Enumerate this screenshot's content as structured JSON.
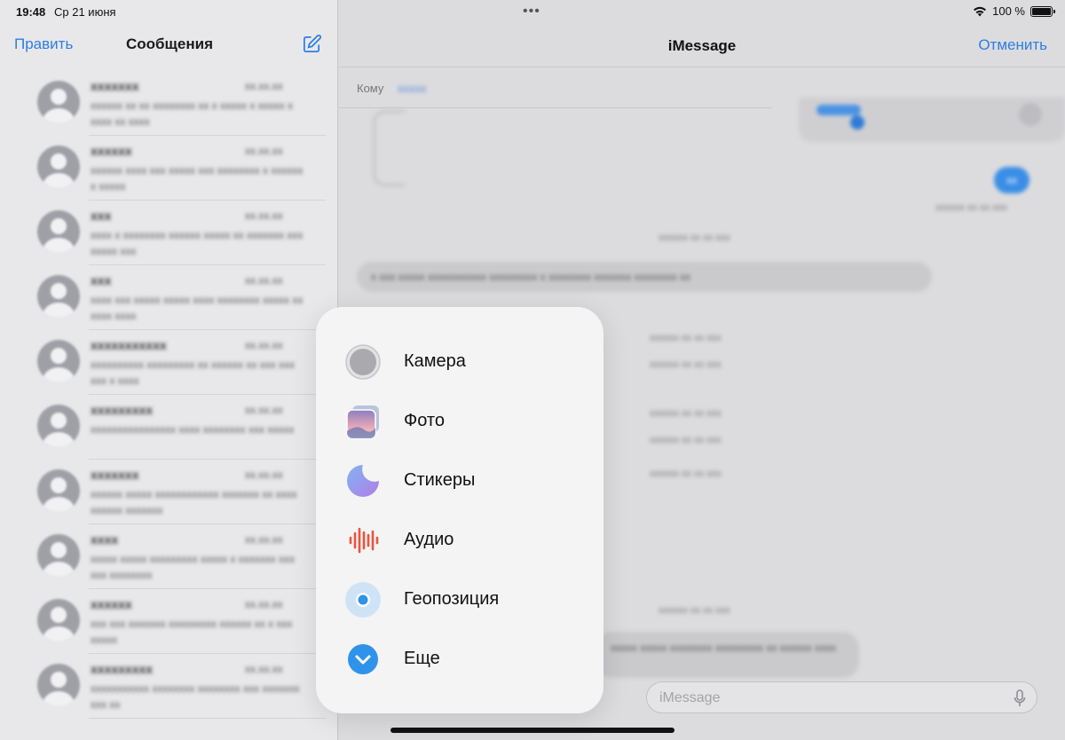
{
  "status_bar": {
    "time": "19:48",
    "date": "Ср 21 июня",
    "dots": "•••",
    "battery_percent": "100 %"
  },
  "sidebar": {
    "edit_label": "Править",
    "title": "Сообщения",
    "conversations": [
      {
        "name": "xxxxxxx",
        "time": "xx.xx.xx",
        "preview": "xxxxxx xx xx xxxxxxxx xx x xxxxx x xxxxx x xxxx xx xxxx"
      },
      {
        "name": "xxxxxx",
        "time": "xx.xx.xx",
        "preview": "xxxxxx xxxx xxx xxxxx xxx xxxxxxxx x xxxxxx x xxxxx"
      },
      {
        "name": "xxx",
        "time": "xx.xx.xx",
        "preview": "xxxx x xxxxxxxx xxxxxx xxxxx xx xxxxxxx xxx xxxxx xxx"
      },
      {
        "name": "xxx",
        "time": "xx.xx.xx",
        "preview": "xxxx xxx xxxxx xxxxx xxxx xxxxxxxx xxxxx xx xxxx xxxx"
      },
      {
        "name": "xxxxxxxxxxx",
        "time": "xx.xx.xx",
        "preview": "xxxxxxxxxx xxxxxxxxx xx xxxxxx xx xxx xxx xxx x xxxx"
      },
      {
        "name": "xxxxxxxxx",
        "time": "xx.xx.xx",
        "preview": "xxxxxxxxxxxxxxxx xxxx xxxxxxxx xxx xxxxx"
      },
      {
        "name": "xxxxxxx",
        "time": "xx.xx.xx",
        "preview": "xxxxxx xxxxx xxxxxxxxxxxx xxxxxxx xx xxxx xxxxxx xxxxxxx"
      },
      {
        "name": "xxxx",
        "time": "xx.xx.xx",
        "preview": "xxxxx xxxxx xxxxxxxxx xxxxx x xxxxxxx xxx xxx xxxxxxxx"
      },
      {
        "name": "xxxxxx",
        "time": "xx.xx.xx",
        "preview": "xxx xxx xxxxxxx xxxxxxxxx xxxxxx xx x xxx xxxxx"
      },
      {
        "name": "xxxxxxxxx",
        "time": "xx.xx.xx",
        "preview": "xxxxxxxxxxx xxxxxxxx xxxxxxxx xxx xxxxxxx xxx xx"
      }
    ]
  },
  "conversation": {
    "title": "iMessage",
    "cancel_label": "Отменить",
    "to_label": "Кому",
    "recipient": "xxxxx",
    "input_placeholder": "iMessage",
    "blurred_blue_bubble": "xx",
    "blurred_long_message": "x xxx xxxxx xxxxxxxxxxx xxxxxxxxx x xxxxxxxx xxxxxxx xxxxxxxx xx",
    "blurred_bottom_message": "xxxxx xxxxx xxxxxxxx xxxxxxxxx xx xxxxxx xxxx",
    "blurred_meta": "xxxxxx xx xx xxx"
  },
  "menu": {
    "items": [
      {
        "label": "Камера",
        "icon": "camera-icon"
      },
      {
        "label": "Фото",
        "icon": "photos-icon"
      },
      {
        "label": "Стикеры",
        "icon": "stickers-icon"
      },
      {
        "label": "Аудио",
        "icon": "audio-waveform-icon"
      },
      {
        "label": "Геопозиция",
        "icon": "location-icon"
      },
      {
        "label": "Еще",
        "icon": "more-chevron-icon"
      }
    ]
  },
  "colors": {
    "accent": "#2d7de3",
    "audio": "#e8543f",
    "location": "#2f93ea",
    "more": "#2f93ea"
  }
}
